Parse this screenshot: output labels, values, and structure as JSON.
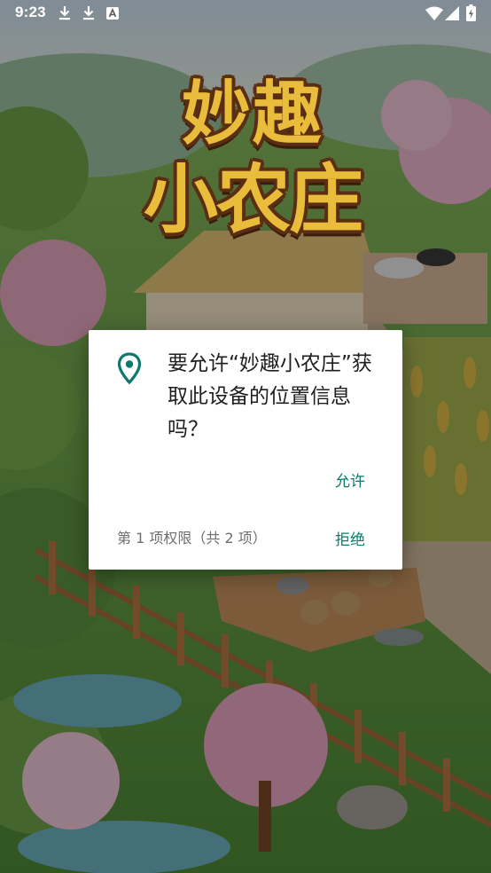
{
  "status_bar": {
    "time": "9:23",
    "left_icons": [
      "download-icon",
      "download-icon",
      "accessibility-icon"
    ],
    "right_icons": [
      "wifi-icon",
      "cellular-signal-icon",
      "battery-charging-icon"
    ]
  },
  "game": {
    "logo_line1": "妙趣",
    "logo_line2": "小农庄"
  },
  "dialog": {
    "message": "要允许“妙趣小农庄”获取此设备的位置信息吗？",
    "icon": "location-pin-icon",
    "allow_label": "允许",
    "deny_label": "拒绝",
    "counter": "第 1 项权限（共 2 项）",
    "accent_color": "#0c7a6b"
  }
}
